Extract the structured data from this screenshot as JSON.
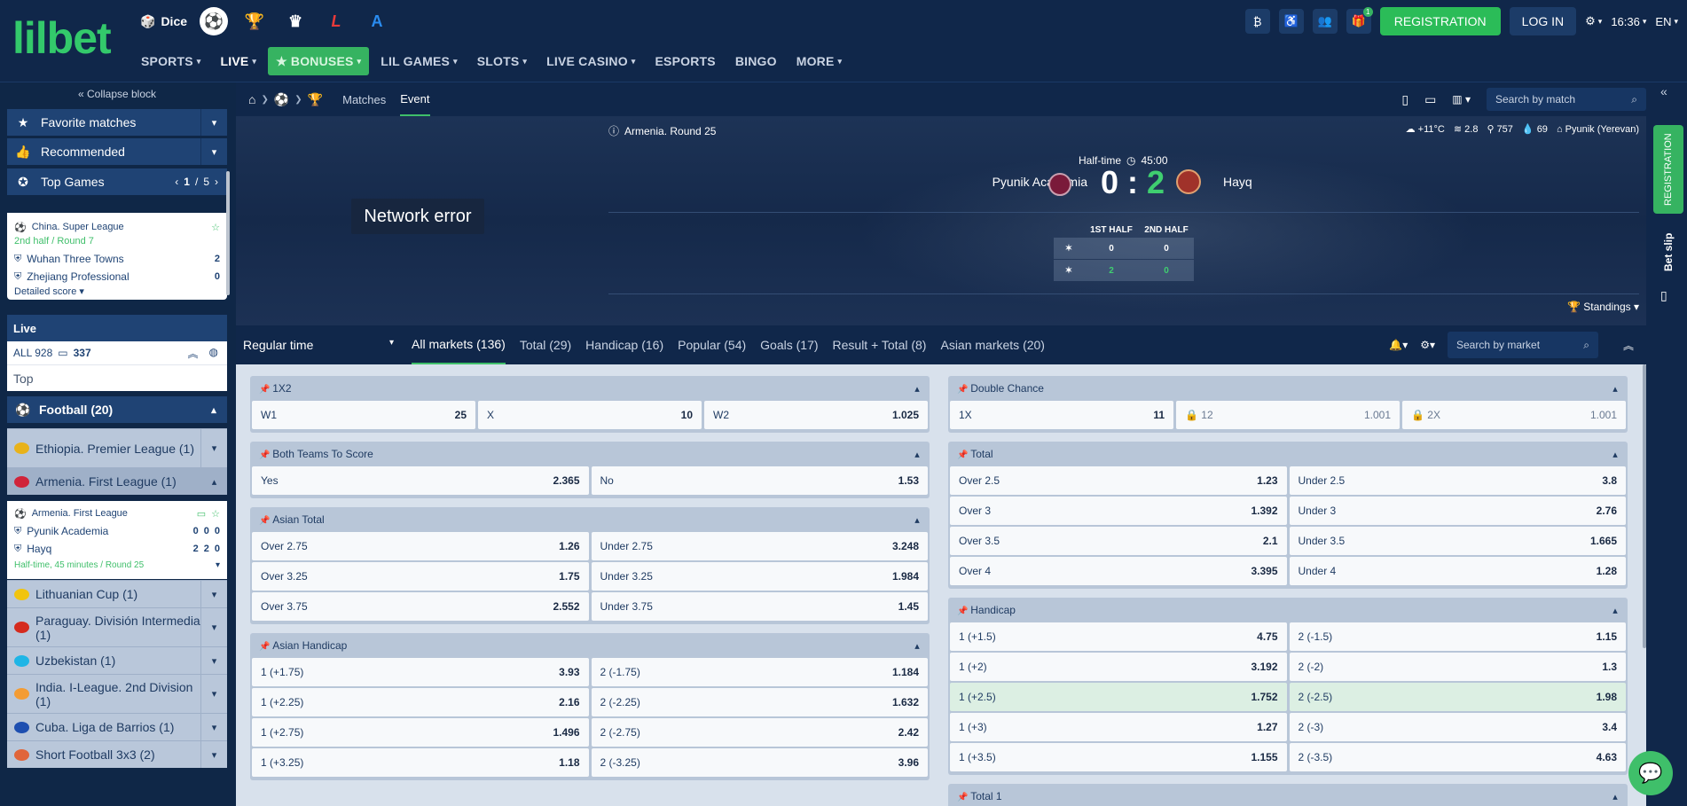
{
  "header": {
    "logo": "lilbet",
    "top_links": [
      {
        "label": "Dice",
        "icon": "dice-icon"
      },
      {
        "label": "",
        "icon": "soccer-ball-icon"
      },
      {
        "label": "",
        "icon": "europa-league-icon"
      },
      {
        "label": "",
        "icon": "premier-league-icon"
      },
      {
        "label": "",
        "icon": "laliga-icon"
      },
      {
        "label": "",
        "icon": "serie-a-icon"
      }
    ],
    "nav": [
      "SPORTS",
      "LIVE",
      "BONUSES",
      "LIL GAMES",
      "SLOTS",
      "LIVE CASINO",
      "ESPORTS",
      "BINGO",
      "MORE"
    ],
    "register_label": "REGISTRATION",
    "login_label": "LOG IN",
    "time": "16:36",
    "lang": "EN",
    "gift_badge": "1"
  },
  "sidebar": {
    "collapse_label": "Collapse block",
    "favorite_label": "Favorite matches",
    "recommended_label": "Recommended",
    "top_games_label": "Top Games",
    "top_games_page": "1",
    "top_games_total": "5",
    "top_game": {
      "league": "China. Super League",
      "status": "2nd half / Round 7",
      "team1": "Wuhan Three Towns",
      "score1": "2",
      "team2": "Zhejiang Professional",
      "score2": "0",
      "detail_label": "Detailed score"
    },
    "live_label": "Live",
    "all_label": "ALL 928",
    "all_stream_count": "337",
    "top_label": "Top",
    "football_label": "Football (20)",
    "leagues": [
      {
        "name": "Ethiopia. Premier League (1)",
        "flag": "#e8b21a"
      },
      {
        "name": "Armenia. First League (1)",
        "flag": "#d0243a"
      },
      {
        "name": "Lithuanian Cup (1)",
        "flag": "#f1c40f"
      },
      {
        "name": "Paraguay. División Intermedia (1)",
        "flag": "#d52b1e"
      },
      {
        "name": "Uzbekistan (1)",
        "flag": "#1eb5e6"
      },
      {
        "name": "India. I-League. 2nd Division (1)",
        "flag": "#f39c34"
      },
      {
        "name": "Cuba. Liga de Barrios (1)",
        "flag": "#1e4fb0"
      },
      {
        "name": "Short Football 3x3 (2)",
        "flag": "#e0653a"
      }
    ],
    "arm_match": {
      "league": "Armenia. First League",
      "team1": "Pyunik Academia",
      "t1_scores": [
        "0",
        "0",
        "0"
      ],
      "team2": "Hayq",
      "t2_scores": [
        "2",
        "2",
        "0"
      ],
      "status": "Half-time, 45 minutes / Round 25"
    }
  },
  "breadcrumb": {
    "tab1": "Matches",
    "tab2": "Event",
    "search_placeholder": "Search by match"
  },
  "event": {
    "network_error": "Network error",
    "round": "Armenia. Round 25",
    "weather": {
      "temp": "+11°C",
      "wind": "2.8",
      "pressure": "757",
      "humidity": "69",
      "venue": "Pyunik (Yerevan)"
    },
    "period": "Half-time",
    "clock": "45:00",
    "team1": "Pyunik Academia",
    "team2": "Hayq",
    "score1": "0",
    "score2": "2",
    "half_headers": [
      "1ST HALF",
      "2ND HALF"
    ],
    "half_scores_t1": [
      "0",
      "0"
    ],
    "half_scores_t2": [
      "2",
      "0"
    ],
    "standings_label": "Standings"
  },
  "market_tabs": {
    "regular_time": "Regular time",
    "tabs": [
      "All markets (136)",
      "Total (29)",
      "Handicap (16)",
      "Popular (54)",
      "Goals (17)",
      "Result + Total (8)",
      "Asian markets (20)"
    ],
    "search_placeholder": "Search by market"
  },
  "markets_left": [
    {
      "title": "1X2",
      "rows": [
        [
          {
            "l": "W1",
            "v": "25"
          },
          {
            "l": "X",
            "v": "10"
          },
          {
            "l": "W2",
            "v": "1.025"
          }
        ]
      ]
    },
    {
      "title": "Both Teams To Score",
      "rows": [
        [
          {
            "l": "Yes",
            "v": "2.365"
          },
          {
            "l": "No",
            "v": "1.53"
          }
        ]
      ]
    },
    {
      "title": "Asian Total",
      "rows": [
        [
          {
            "l": "Over 2.75",
            "v": "1.26"
          },
          {
            "l": "Under 2.75",
            "v": "3.248"
          }
        ],
        [
          {
            "l": "Over 3.25",
            "v": "1.75"
          },
          {
            "l": "Under 3.25",
            "v": "1.984"
          }
        ],
        [
          {
            "l": "Over 3.75",
            "v": "2.552"
          },
          {
            "l": "Under 3.75",
            "v": "1.45"
          }
        ]
      ]
    },
    {
      "title": "Asian Handicap",
      "rows": [
        [
          {
            "l": "1 (+1.75)",
            "v": "3.93"
          },
          {
            "l": "2 (-1.75)",
            "v": "1.184"
          }
        ],
        [
          {
            "l": "1 (+2.25)",
            "v": "2.16"
          },
          {
            "l": "2 (-2.25)",
            "v": "1.632"
          }
        ],
        [
          {
            "l": "1 (+2.75)",
            "v": "1.496"
          },
          {
            "l": "2 (-2.75)",
            "v": "2.42"
          }
        ],
        [
          {
            "l": "1 (+3.25)",
            "v": "1.18"
          },
          {
            "l": "2 (-3.25)",
            "v": "3.96"
          }
        ]
      ]
    }
  ],
  "markets_right": [
    {
      "title": "Double Chance",
      "rows": [
        [
          {
            "l": "1X",
            "v": "11"
          },
          {
            "l": "12",
            "v": "1.001",
            "lock": true
          },
          {
            "l": "2X",
            "v": "1.001",
            "lock": true
          }
        ]
      ]
    },
    {
      "title": "Total",
      "rows": [
        [
          {
            "l": "Over 2.5",
            "v": "1.23"
          },
          {
            "l": "Under 2.5",
            "v": "3.8"
          }
        ],
        [
          {
            "l": "Over 3",
            "v": "1.392"
          },
          {
            "l": "Under 3",
            "v": "2.76"
          }
        ],
        [
          {
            "l": "Over 3.5",
            "v": "2.1"
          },
          {
            "l": "Under 3.5",
            "v": "1.665"
          }
        ],
        [
          {
            "l": "Over 4",
            "v": "3.395"
          },
          {
            "l": "Under 4",
            "v": "1.28"
          }
        ]
      ]
    },
    {
      "title": "Handicap",
      "rows": [
        [
          {
            "l": "1 (+1.5)",
            "v": "4.75"
          },
          {
            "l": "2 (-1.5)",
            "v": "1.15"
          }
        ],
        [
          {
            "l": "1 (+2)",
            "v": "3.192"
          },
          {
            "l": "2 (-2)",
            "v": "1.3"
          }
        ],
        [
          {
            "l": "1 (+2.5)",
            "v": "1.752",
            "hl": true
          },
          {
            "l": "2 (-2.5)",
            "v": "1.98",
            "hl": true
          }
        ],
        [
          {
            "l": "1 (+3)",
            "v": "1.27"
          },
          {
            "l": "2 (-3)",
            "v": "3.4"
          }
        ],
        [
          {
            "l": "1 (+3.5)",
            "v": "1.155"
          },
          {
            "l": "2 (-3.5)",
            "v": "4.63"
          }
        ]
      ]
    },
    {
      "title": "Total 1",
      "rows": []
    }
  ],
  "right_strip": {
    "register_label": "REGISTRATION",
    "betslip_label": "Bet slip"
  }
}
